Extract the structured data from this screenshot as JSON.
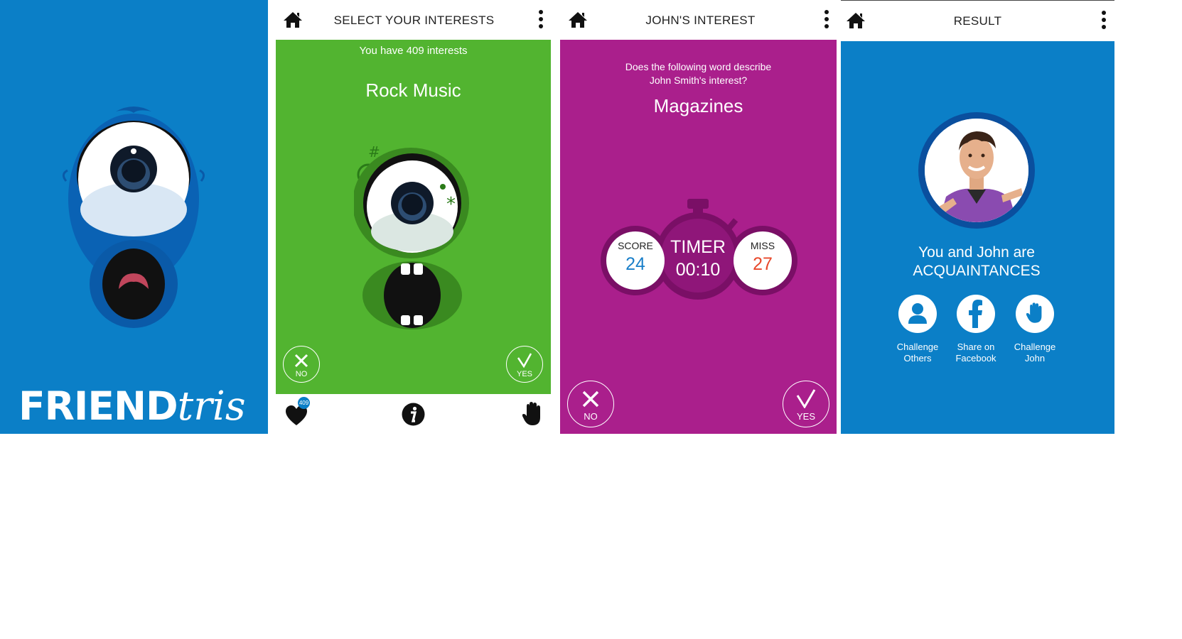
{
  "colors": {
    "blue": "#0b7fc7",
    "green": "#52b430",
    "magenta": "#aa1f8c",
    "dark_magenta": "#7a0f66",
    "score_blue": "#1a7fc9",
    "miss_red": "#e8482b"
  },
  "splash": {
    "logo_bold": "FRIEND",
    "logo_script": "tris"
  },
  "interests": {
    "title": "SELECT YOUR INTERESTS",
    "count_text": "You have 409 interests",
    "interest": "Rock Music",
    "no_label": "NO",
    "yes_label": "YES",
    "badge_count": "409",
    "icons": {
      "home": "home-icon",
      "menu": "more-vert-icon",
      "favorites": "heart-icon",
      "info": "info-icon",
      "challenge": "hand-icon"
    }
  },
  "guess": {
    "title": "JOHN'S INTEREST",
    "question_line1": "Does the following word describe",
    "question_line2": "John Smith's interest?",
    "word": "Magazines",
    "score_label": "SCORE",
    "score_value": "24",
    "timer_label": "TIMER",
    "timer_value": "00:10",
    "miss_label": "MISS",
    "miss_value": "27",
    "no_label": "NO",
    "yes_label": "YES"
  },
  "result": {
    "title": "RESULT",
    "line1": "You and John are",
    "line2": "ACQUAINTANCES",
    "actions": [
      {
        "line1": "Challenge",
        "line2": "Others",
        "icon": "person-icon"
      },
      {
        "line1": "Share on",
        "line2": "Facebook",
        "icon": "facebook-icon"
      },
      {
        "line1": "Challenge",
        "line2": "John",
        "icon": "hand-icon"
      }
    ]
  }
}
